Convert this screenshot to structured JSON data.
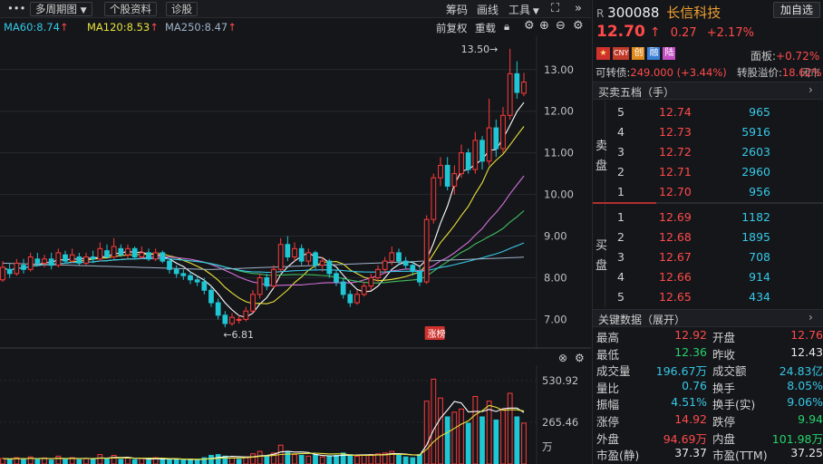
{
  "toolbar": {
    "menu_icon": "menu-dots-icon",
    "period": "多周期图",
    "stock_info": "个股资料",
    "diagnose": "诊股",
    "chips": "筹码",
    "draw": "画线",
    "tools": "工具",
    "expand_icon": "expand-icon",
    "collapse_icon": "double-chevron-right-icon"
  },
  "ma": {
    "ma60": "MA60:8.74",
    "ma120": "MA120:8.53",
    "ma250": "MA250:8.47",
    "up_arrow": "↑",
    "adjust": "前复权",
    "overlay": "重载",
    "colors": {
      "ma60": "#35c8e6",
      "ma120": "#e8e23a",
      "ma250": "#9fb3c8"
    }
  },
  "chart_data": {
    "type": "candlestick",
    "price_ticks": [
      "13.00",
      "12.00",
      "11.00",
      "10.00",
      "9.00",
      "8.00",
      "7.00"
    ],
    "price_tick_values": [
      13,
      12,
      11,
      10,
      9,
      8,
      7
    ],
    "ylim": [
      6.4,
      13.8
    ],
    "high_label": "13.50→",
    "low_label": "←6.81",
    "high_value": 13.5,
    "low_value": 6.81,
    "badge": "涨榜",
    "volume_ticks": [
      "530.92",
      "265.46",
      "万"
    ],
    "volume_tick_values": [
      530.92,
      265.46
    ],
    "volume_max": 600,
    "candles": [
      [
        7.95,
        8.25,
        8.4,
        7.9
      ],
      [
        8.2,
        8.1,
        8.35,
        8.0
      ],
      [
        8.1,
        8.35,
        8.45,
        8.05
      ],
      [
        8.3,
        8.2,
        8.45,
        8.1
      ],
      [
        8.2,
        8.5,
        8.6,
        8.15
      ],
      [
        8.45,
        8.35,
        8.6,
        8.3
      ],
      [
        8.35,
        8.45,
        8.55,
        8.25
      ],
      [
        8.45,
        8.3,
        8.6,
        8.2
      ],
      [
        8.3,
        8.6,
        8.7,
        8.25
      ],
      [
        8.55,
        8.4,
        8.65,
        8.35
      ],
      [
        8.4,
        8.55,
        8.7,
        8.35
      ],
      [
        8.5,
        8.35,
        8.6,
        8.3
      ],
      [
        8.35,
        8.5,
        8.6,
        8.3
      ],
      [
        8.5,
        8.45,
        8.65,
        8.35
      ],
      [
        8.45,
        8.7,
        8.85,
        8.4
      ],
      [
        8.65,
        8.5,
        8.8,
        8.45
      ],
      [
        8.5,
        8.75,
        8.95,
        8.45
      ],
      [
        8.7,
        8.55,
        8.8,
        8.5
      ],
      [
        8.55,
        8.7,
        8.8,
        8.45
      ],
      [
        8.7,
        8.5,
        8.75,
        8.45
      ],
      [
        8.5,
        8.6,
        8.75,
        8.45
      ],
      [
        8.6,
        8.45,
        8.7,
        8.4
      ],
      [
        8.45,
        8.6,
        8.7,
        8.4
      ],
      [
        8.6,
        8.4,
        8.65,
        8.35
      ],
      [
        8.4,
        8.2,
        8.45,
        8.1
      ],
      [
        8.2,
        8.1,
        8.3,
        8.0
      ],
      [
        8.1,
        8.05,
        8.2,
        7.95
      ],
      [
        8.05,
        7.95,
        8.15,
        7.85
      ],
      [
        7.95,
        7.9,
        8.05,
        7.8
      ],
      [
        7.9,
        7.7,
        8.0,
        7.6
      ],
      [
        7.7,
        7.4,
        7.8,
        7.3
      ],
      [
        7.4,
        7.1,
        7.5,
        7.0
      ],
      [
        7.1,
        6.9,
        7.2,
        6.81
      ],
      [
        6.9,
        7.05,
        7.15,
        6.85
      ],
      [
        7.0,
        7.0,
        7.1,
        6.9
      ],
      [
        7.0,
        7.2,
        7.3,
        6.95
      ],
      [
        7.2,
        7.6,
        7.7,
        7.15
      ],
      [
        7.6,
        8.0,
        8.1,
        7.5
      ],
      [
        8.0,
        7.8,
        8.1,
        7.7
      ],
      [
        7.8,
        8.2,
        8.3,
        7.75
      ],
      [
        8.2,
        8.8,
        8.95,
        8.15
      ],
      [
        8.8,
        8.5,
        9.0,
        8.4
      ],
      [
        8.5,
        8.7,
        8.85,
        8.4
      ],
      [
        8.7,
        8.4,
        8.8,
        8.3
      ],
      [
        8.4,
        8.6,
        8.7,
        8.3
      ],
      [
        8.6,
        8.3,
        8.65,
        8.2
      ],
      [
        8.3,
        8.4,
        8.5,
        8.15
      ],
      [
        8.4,
        8.1,
        8.45,
        8.0
      ],
      [
        8.1,
        7.9,
        8.2,
        7.8
      ],
      [
        7.9,
        7.6,
        8.0,
        7.5
      ],
      [
        7.6,
        7.4,
        7.7,
        7.3
      ],
      [
        7.4,
        7.6,
        7.7,
        7.35
      ],
      [
        7.6,
        7.8,
        7.9,
        7.55
      ],
      [
        7.8,
        8.0,
        8.1,
        7.7
      ],
      [
        8.0,
        8.2,
        8.3,
        7.9
      ],
      [
        8.2,
        8.4,
        8.5,
        8.1
      ],
      [
        8.4,
        8.6,
        8.75,
        8.3
      ],
      [
        8.6,
        8.4,
        8.7,
        8.3
      ],
      [
        8.4,
        8.3,
        8.5,
        8.2
      ],
      [
        8.3,
        8.15,
        8.4,
        8.05
      ],
      [
        8.15,
        7.9,
        8.25,
        7.8
      ],
      [
        7.9,
        9.4,
        9.5,
        7.85
      ],
      [
        9.4,
        10.4,
        10.5,
        9.3
      ],
      [
        10.4,
        10.7,
        10.9,
        10.2
      ],
      [
        10.7,
        10.2,
        10.9,
        10.1
      ],
      [
        10.2,
        10.5,
        10.7,
        10.0
      ],
      [
        10.5,
        11.0,
        11.2,
        10.4
      ],
      [
        11.0,
        10.6,
        11.1,
        10.5
      ],
      [
        10.6,
        11.3,
        11.5,
        10.5
      ],
      [
        11.3,
        10.8,
        11.4,
        10.6
      ],
      [
        10.8,
        11.6,
        12.3,
        10.7
      ],
      [
        11.6,
        11.1,
        11.8,
        10.9
      ],
      [
        11.1,
        11.9,
        12.1,
        11.0
      ],
      [
        11.9,
        12.9,
        13.5,
        11.8
      ],
      [
        12.9,
        12.45,
        13.2,
        12.3
      ],
      [
        12.43,
        12.7,
        12.92,
        12.36
      ]
    ],
    "volumes": [
      [
        35,
        1
      ],
      [
        30,
        0
      ],
      [
        40,
        1
      ],
      [
        28,
        0
      ],
      [
        45,
        1
      ],
      [
        30,
        0
      ],
      [
        38,
        1
      ],
      [
        25,
        0
      ],
      [
        50,
        1
      ],
      [
        30,
        0
      ],
      [
        40,
        1
      ],
      [
        28,
        0
      ],
      [
        35,
        1
      ],
      [
        30,
        0
      ],
      [
        60,
        1
      ],
      [
        32,
        0
      ],
      [
        55,
        1
      ],
      [
        30,
        0
      ],
      [
        38,
        1
      ],
      [
        28,
        0
      ],
      [
        35,
        1
      ],
      [
        25,
        0
      ],
      [
        40,
        1
      ],
      [
        30,
        0
      ],
      [
        28,
        0
      ],
      [
        32,
        0
      ],
      [
        26,
        0
      ],
      [
        30,
        0
      ],
      [
        24,
        0
      ],
      [
        40,
        0
      ],
      [
        55,
        0
      ],
      [
        60,
        0
      ],
      [
        50,
        0
      ],
      [
        38,
        1
      ],
      [
        30,
        0
      ],
      [
        45,
        1
      ],
      [
        65,
        1
      ],
      [
        80,
        1
      ],
      [
        50,
        0
      ],
      [
        70,
        1
      ],
      [
        120,
        1
      ],
      [
        80,
        0
      ],
      [
        60,
        1
      ],
      [
        55,
        0
      ],
      [
        50,
        1
      ],
      [
        60,
        0
      ],
      [
        45,
        1
      ],
      [
        50,
        0
      ],
      [
        55,
        0
      ],
      [
        70,
        0
      ],
      [
        60,
        0
      ],
      [
        50,
        1
      ],
      [
        55,
        1
      ],
      [
        60,
        1
      ],
      [
        65,
        1
      ],
      [
        70,
        1
      ],
      [
        80,
        1
      ],
      [
        55,
        0
      ],
      [
        45,
        0
      ],
      [
        40,
        0
      ],
      [
        60,
        0
      ],
      [
        400,
        1
      ],
      [
        540,
        1
      ],
      [
        420,
        1
      ],
      [
        300,
        0
      ],
      [
        330,
        1
      ],
      [
        350,
        1
      ],
      [
        260,
        0
      ],
      [
        430,
        1
      ],
      [
        300,
        0
      ],
      [
        400,
        1
      ],
      [
        280,
        0
      ],
      [
        350,
        1
      ],
      [
        450,
        1
      ],
      [
        300,
        0
      ],
      [
        260,
        1
      ]
    ]
  },
  "stock": {
    "prefix": "R",
    "code": "300088",
    "name": "长信科技",
    "add_button": "加自选",
    "price": "12.70",
    "price_arrow": "↑",
    "change": "0.27",
    "change_pct": "+2.17%",
    "badges": [
      "CNY",
      "创",
      "融",
      "陆"
    ],
    "board": "面板:",
    "board_value": "+0.72%",
    "status": "闭市",
    "convertible_label": "可转债:",
    "convertible_value": "249.000 (+3.44%)",
    "premium_label": "转股溢价:",
    "premium_value": "18.62%"
  },
  "orderbook": {
    "title": "买卖五档（手）",
    "sell_label": [
      "卖",
      "盘"
    ],
    "buy_label": [
      "买",
      "盘"
    ],
    "sells": [
      {
        "level": "5",
        "price": "12.74",
        "vol": "965"
      },
      {
        "level": "4",
        "price": "12.73",
        "vol": "5916"
      },
      {
        "level": "3",
        "price": "12.72",
        "vol": "2603"
      },
      {
        "level": "2",
        "price": "12.71",
        "vol": "2960"
      },
      {
        "level": "1",
        "price": "12.70",
        "vol": "956"
      }
    ],
    "buys": [
      {
        "level": "1",
        "price": "12.69",
        "vol": "1182"
      },
      {
        "level": "2",
        "price": "12.68",
        "vol": "1895"
      },
      {
        "level": "3",
        "price": "12.67",
        "vol": "708"
      },
      {
        "level": "4",
        "price": "12.66",
        "vol": "914"
      },
      {
        "level": "5",
        "price": "12.65",
        "vol": "434"
      }
    ]
  },
  "key": {
    "title": "关键数据（展开）",
    "rows": [
      {
        "l1": "最高",
        "v1": "12.92",
        "c1": "red",
        "l2": "开盘",
        "v2": "12.76",
        "c2": "red"
      },
      {
        "l1": "最低",
        "v1": "12.36",
        "c1": "green",
        "l2": "昨收",
        "v2": "12.43",
        "c2": "white"
      },
      {
        "l1": "成交量",
        "v1": "196.67万",
        "c1": "cyan",
        "l2": "成交额",
        "v2": "24.83亿",
        "c2": "cyan"
      },
      {
        "l1": "量比",
        "v1": "0.76",
        "c1": "cyan",
        "l2": "换手",
        "v2": "8.05%",
        "c2": "cyan"
      },
      {
        "l1": "振幅",
        "v1": "4.51%",
        "c1": "cyan",
        "l2": "换手(实)",
        "v2": "9.06%",
        "c2": "cyan"
      },
      {
        "l1": "涨停",
        "v1": "14.92",
        "c1": "red",
        "l2": "跌停",
        "v2": "9.94",
        "c2": "green"
      },
      {
        "l1": "外盘",
        "v1": "94.69万",
        "c1": "red",
        "l2": "内盘",
        "v2": "101.98万",
        "c2": "green"
      },
      {
        "l1": "市盈(静)",
        "v1": "37.37",
        "c1": "white",
        "l2": "市盈(TTM)",
        "v2": "37.25",
        "c2": "white"
      }
    ]
  }
}
